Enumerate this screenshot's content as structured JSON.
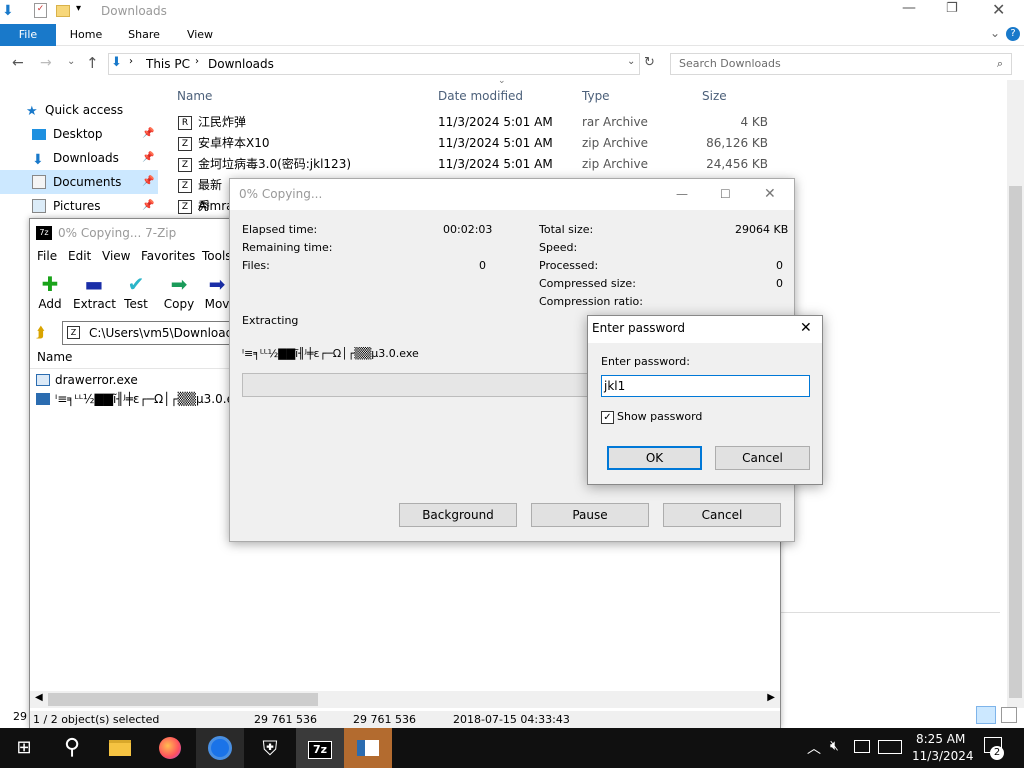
{
  "explorer": {
    "title": "Downloads",
    "ribbon_tabs": [
      "File",
      "Home",
      "Share",
      "View"
    ],
    "breadcrumb": [
      "This PC",
      "Downloads"
    ],
    "search_placeholder": "Search Downloads",
    "nav": [
      {
        "label": "Quick access",
        "icon": "star-icon"
      },
      {
        "label": "Desktop",
        "icon": "desktop-icon"
      },
      {
        "label": "Downloads",
        "icon": "download-icon"
      },
      {
        "label": "Documents",
        "icon": "documents-icon"
      },
      {
        "label": "Pictures",
        "icon": "pictures-icon"
      }
    ],
    "columns": [
      "Name",
      "Date modified",
      "Type",
      "Size"
    ],
    "files": [
      {
        "name": "江民炸弹",
        "date": "11/3/2024 5:01 AM",
        "type": "rar Archive",
        "size": "4 KB"
      },
      {
        "name": "安卓梓本X10",
        "date": "11/3/2024 5:01 AM",
        "type": "zip Archive",
        "size": "86,126 KB"
      },
      {
        "name": "金坷垃病毒3.0(密码:jkl123)",
        "date": "11/3/2024 5:01 AM",
        "type": "zip Archive",
        "size": "24,456 KB"
      },
      {
        "name": "最新秀",
        "date": "",
        "type": "",
        "size": ""
      },
      {
        "name": "Aimra",
        "date": "",
        "type": "",
        "size": ""
      }
    ],
    "item_count_partial": "29"
  },
  "sevenzip": {
    "title": "0% Copying... 7-Zip",
    "menu": [
      "File",
      "Edit",
      "View",
      "Favorites",
      "Tools"
    ],
    "toolbar": [
      "Add",
      "Extract",
      "Test",
      "Copy",
      "Mov"
    ],
    "path": "C:\\Users\\vm5\\Downloads\\",
    "list_header": "Name",
    "items": [
      "drawerror.exe",
      "ᴵ≡╕ᴸᴸ½▇▇ĩ╢ᴶ╪ε┌─Ω│┌▒▒µ3.0.exe"
    ],
    "status": [
      "1 / 2 object(s) selected",
      "29 761 536",
      "29 761 536",
      "2018-07-15 04:33:43"
    ]
  },
  "progress": {
    "title": "0% Copying...",
    "left": [
      {
        "label": "Elapsed time:",
        "value": "00:02:03"
      },
      {
        "label": "Remaining time:",
        "value": ""
      },
      {
        "label": "Files:",
        "value": "0"
      }
    ],
    "right": [
      {
        "label": "Total size:",
        "value": "29064 KB"
      },
      {
        "label": "Speed:",
        "value": ""
      },
      {
        "label": "Processed:",
        "value": "0"
      },
      {
        "label": "Compressed size:",
        "value": "0"
      },
      {
        "label": "Compression ratio:",
        "value": ""
      }
    ],
    "operation": "Extracting",
    "current_file": "ᴵ≡╕ᴸᴸ½▇▇ĩ╢ᴶ╪ε┌─Ω│┌▒▒µ3.0.exe",
    "progress_fraction": 0,
    "buttons": [
      "Background",
      "Pause",
      "Cancel"
    ]
  },
  "password_dialog": {
    "title": "Enter password",
    "label": "Enter password:",
    "value": "jkl1",
    "show_password_label": "Show password",
    "show_password_checked": true,
    "ok": "OK",
    "cancel": "Cancel"
  },
  "taskbar": {
    "apps": [
      "start-icon",
      "search-icon",
      "file-explorer-icon",
      "firefox-icon",
      "chrome-icon",
      "security-icon",
      "7zip-icon",
      "app-icon"
    ],
    "time": "8:25 AM",
    "date": "11/3/2024",
    "notification_count": "2"
  }
}
